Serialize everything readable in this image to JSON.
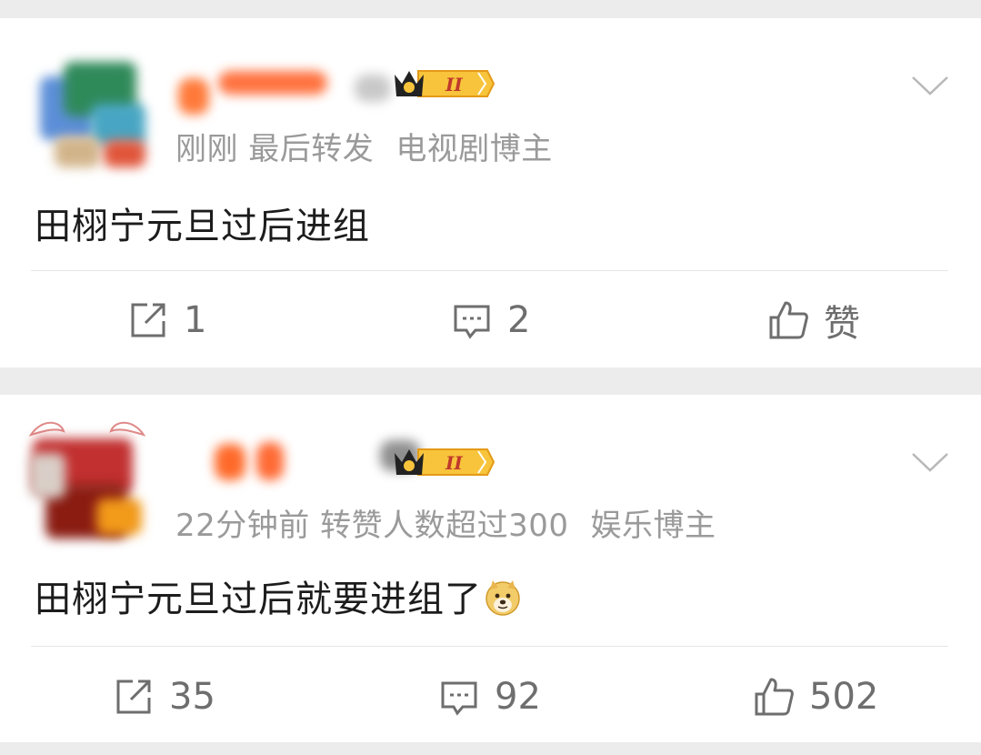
{
  "posts": [
    {
      "meta_time": "刚刚 最后转发",
      "meta_tag": "电视剧博主",
      "text": "田栩宁元旦过后进组",
      "actions": {
        "repost": "1",
        "comment": "2",
        "like": "赞"
      },
      "badge_level": "II"
    },
    {
      "meta_time": "22分钟前 转赞人数超过300",
      "meta_tag": "娱乐博主",
      "text": "田栩宁元旦过后就要进组了",
      "actions": {
        "repost": "35",
        "comment": "92",
        "like": "502"
      },
      "badge_level": "II"
    }
  ],
  "icons": {
    "repost": "repost-icon",
    "comment": "comment-icon",
    "like": "like-icon",
    "more": "chevron-down-icon",
    "badge": "crown-badge-icon",
    "emoji": "doge-emoji-icon"
  },
  "colors": {
    "page_bg": "#ececec",
    "card_bg": "#ffffff",
    "meta_text": "#9a9a9a",
    "body_text": "#1c1c1c",
    "action_text": "#6e6e6e",
    "badge_gold": "#f5b62a",
    "name_blur": "#ff6a2a"
  }
}
